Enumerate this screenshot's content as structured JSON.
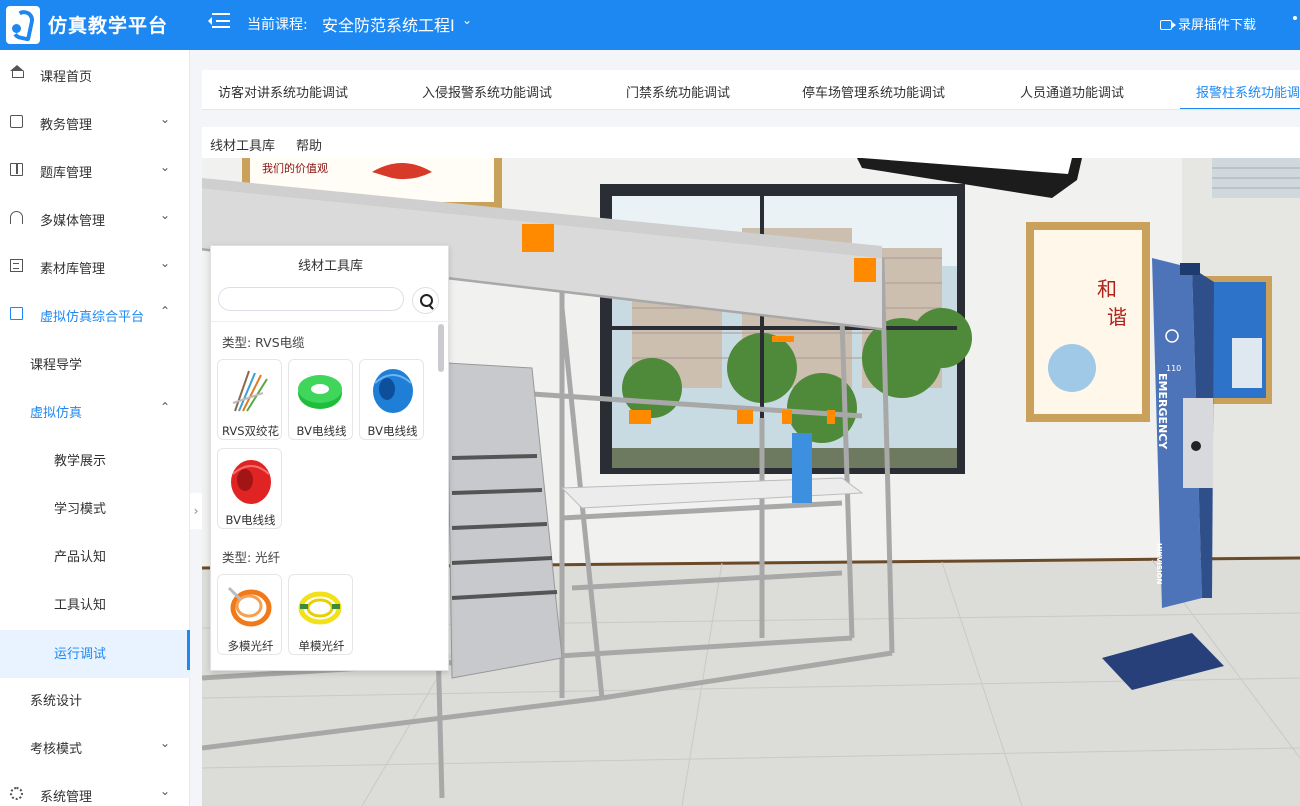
{
  "header": {
    "brand": "仿真教学平台",
    "course_label": "当前课程:",
    "course_name": "安全防范系统工程I",
    "record_label": "录屏插件下载"
  },
  "sidebar": {
    "items": [
      {
        "label": "课程首页"
      },
      {
        "label": "教务管理"
      },
      {
        "label": "题库管理"
      },
      {
        "label": "多媒体管理"
      },
      {
        "label": "素材库管理"
      },
      {
        "label": "虚拟仿真综合平台"
      },
      {
        "label": "课程导学"
      },
      {
        "label": "虚拟仿真"
      },
      {
        "label": "教学展示"
      },
      {
        "label": "学习模式"
      },
      {
        "label": "产品认知"
      },
      {
        "label": "工具认知"
      },
      {
        "label": "运行调试"
      },
      {
        "label": "系统设计"
      },
      {
        "label": "考核模式"
      },
      {
        "label": "系统管理"
      }
    ]
  },
  "tabs": [
    {
      "label": "访客对讲系统功能调试"
    },
    {
      "label": "入侵报警系统功能调试"
    },
    {
      "label": "门禁系统功能调试"
    },
    {
      "label": "停车场管理系统功能调试"
    },
    {
      "label": "人员通道功能调试"
    },
    {
      "label": "报警柱系统功能调试"
    }
  ],
  "toolbar": {
    "cable_library": "线材工具库",
    "help": "帮助"
  },
  "panel": {
    "title": "线材工具库",
    "search_placeholder": "",
    "categories": [
      {
        "label": "类型: RVS电缆",
        "items": [
          {
            "label": "RVS双绞花",
            "color": "#8a6a4a"
          },
          {
            "label": "BV电线线",
            "color": "#1ebd3c"
          },
          {
            "label": "BV电线线",
            "color": "#1f7fd6"
          },
          {
            "label": "BV电线线",
            "color": "#e02424"
          }
        ]
      },
      {
        "label": "类型: 光纤",
        "items": [
          {
            "label": "多模光纤",
            "color": "#f07a1a"
          },
          {
            "label": "单模光纤",
            "color": "#f2e11a"
          }
        ]
      }
    ]
  },
  "scene": {
    "pillar_text": "EMERGENCY",
    "pillar_brand": "HIKVISION",
    "pillar_number": "110",
    "poster_char1": "和",
    "poster_char2": "谐"
  },
  "colors": {
    "primary": "#1e88f2",
    "orange_marker": "#ff8a00"
  }
}
